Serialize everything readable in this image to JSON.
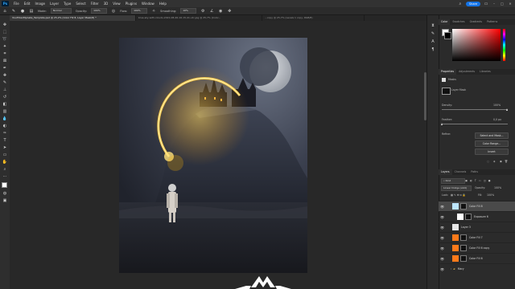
{
  "menu": {
    "logo": "Ps",
    "items": [
      "File",
      "Edit",
      "Image",
      "Layer",
      "Type",
      "Select",
      "Filter",
      "3D",
      "View",
      "Plugins",
      "Window",
      "Help"
    ],
    "share_label": "Share"
  },
  "options": {
    "mode_label": "Mode:",
    "mode_value": "Normal",
    "opacity_label": "Opacity:",
    "opacity_value": "100%",
    "flow_label": "Flow:",
    "flow_value": "100%",
    "smoothing_label": "Smoothing:",
    "smoothing_value": "10%"
  },
  "tabs": [
    {
      "label": "YourEdenMyGate_Template.psd @ 25,2% (Color Fill 8, Layer Mask/8) *",
      "active": true
    },
    {
      "label": "blue-sky-with-clouds-2021-08-26-16-15-41-utc.jpg @ 25,7% (Color...",
      "active": false
    },
    {
      "label": "...copy @ 25,7% (Levels 1 copy, RGB/8)",
      "active": false
    }
  ],
  "color_panel": {
    "tabs": [
      "Color",
      "Swatches",
      "Gradients",
      "Patterns"
    ],
    "foreground": "#ffffff",
    "background": "#000000",
    "hue": "#ff0000"
  },
  "properties_panel": {
    "tabs": [
      "Properties",
      "Adjustments",
      "Libraries"
    ],
    "header": "Masks",
    "mask_type": "Layer Mask",
    "density_label": "Density:",
    "density_value": "100%",
    "feather_label": "Feather:",
    "feather_value": "0,0 px",
    "refine_label": "Refine:",
    "select_and_mask": "Select and Mask...",
    "color_range": "Color Range...",
    "invert": "Invert"
  },
  "layers_panel": {
    "tabs": [
      "Layers",
      "Channels",
      "Paths"
    ],
    "search_placeholder": "Kind",
    "blend_mode": "Linear Dodge (Add)",
    "opacity_label": "Opacity:",
    "opacity_value": "100%",
    "lock_label": "Lock:",
    "fill_label": "Fill:",
    "fill_value": "100%",
    "layers": [
      {
        "name": "Color Fill 8",
        "thumb": "#bde6ff",
        "mask": true,
        "selected": true
      },
      {
        "name": "Exposure 6",
        "thumb": "#ffffff",
        "mask": true,
        "selected": false
      },
      {
        "name": "Layer 3",
        "thumb": "#e8e8e8",
        "mask": false,
        "selected": false
      },
      {
        "name": "Color Fill 7",
        "thumb": "#ff7a1a",
        "mask": true,
        "selected": false
      },
      {
        "name": "Color Fill 6 copy",
        "thumb": "#ff7a1a",
        "mask": true,
        "selected": false
      },
      {
        "name": "Color Fill 6",
        "thumb": "#ff7a1a",
        "mask": true,
        "selected": false
      },
      {
        "name": "Mary",
        "thumb": "#555555",
        "mask": false,
        "selected": false
      }
    ]
  }
}
